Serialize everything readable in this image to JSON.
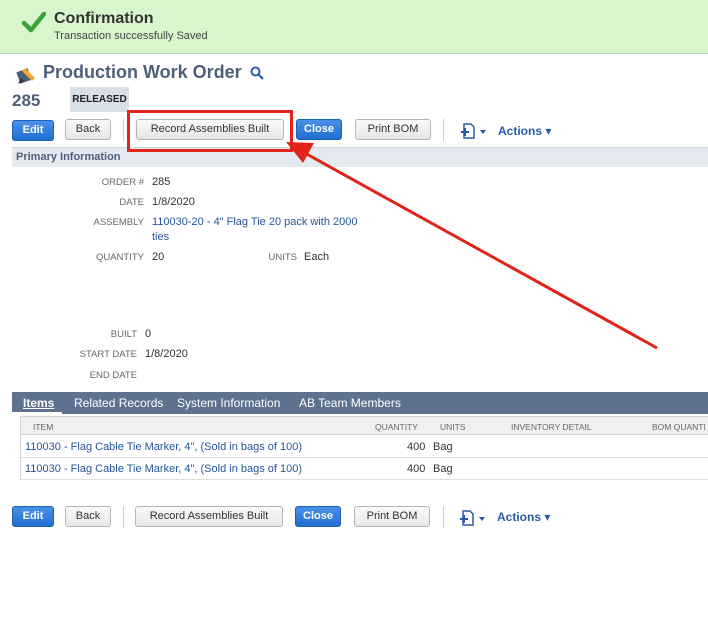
{
  "banner": {
    "title": "Confirmation",
    "message": "Transaction successfully Saved",
    "icon": "check-icon",
    "color": "#d8f5cd"
  },
  "header": {
    "title": "Production Work Order",
    "record_number": "285",
    "status": "RELEASED"
  },
  "toolbar": {
    "edit": "Edit",
    "back": "Back",
    "record_assemblies": "Record Assemblies Built",
    "close": "Close",
    "print_bom": "Print BOM",
    "actions": "Actions ▾",
    "new_record_icon": "new-record-icon"
  },
  "primary": {
    "section_title": "Primary Information",
    "fields": {
      "order_label": "ORDER #",
      "order_value": "285",
      "date_label": "DATE",
      "date_value": "1/8/2020",
      "assembly_label": "ASSEMBLY",
      "assembly_value_1": "110030-20 - 4\" Flag Tie 20 pack with 2000",
      "assembly_value_2": "ties",
      "quantity_label": "QUANTITY",
      "quantity_value": "20",
      "units_label": "UNITS",
      "units_value": "Each",
      "built_label": "BUILT",
      "built_value": "0",
      "start_date_label": "START DATE",
      "start_date_value": "1/8/2020",
      "end_date_label": "END DATE",
      "end_date_value": ""
    }
  },
  "tabs": [
    {
      "label": "Items",
      "active": true
    },
    {
      "label": "Related Records",
      "active": false
    },
    {
      "label": "System Information",
      "active": false
    },
    {
      "label": "AB Team Members",
      "active": false
    }
  ],
  "items_table": {
    "columns": [
      "ITEM",
      "QUANTITY",
      "UNITS",
      "INVENTORY DETAIL",
      "BOM QUANTI"
    ],
    "rows": [
      {
        "item": "110030 - Flag Cable Tie Marker, 4\", (Sold in bags of 100)",
        "quantity": "400",
        "units": "Bag"
      },
      {
        "item": "110030 - Flag Cable Tie Marker, 4\", (Sold in bags of 100)",
        "quantity": "400",
        "units": "Bag"
      }
    ]
  },
  "annotation_color": "#e0241b"
}
